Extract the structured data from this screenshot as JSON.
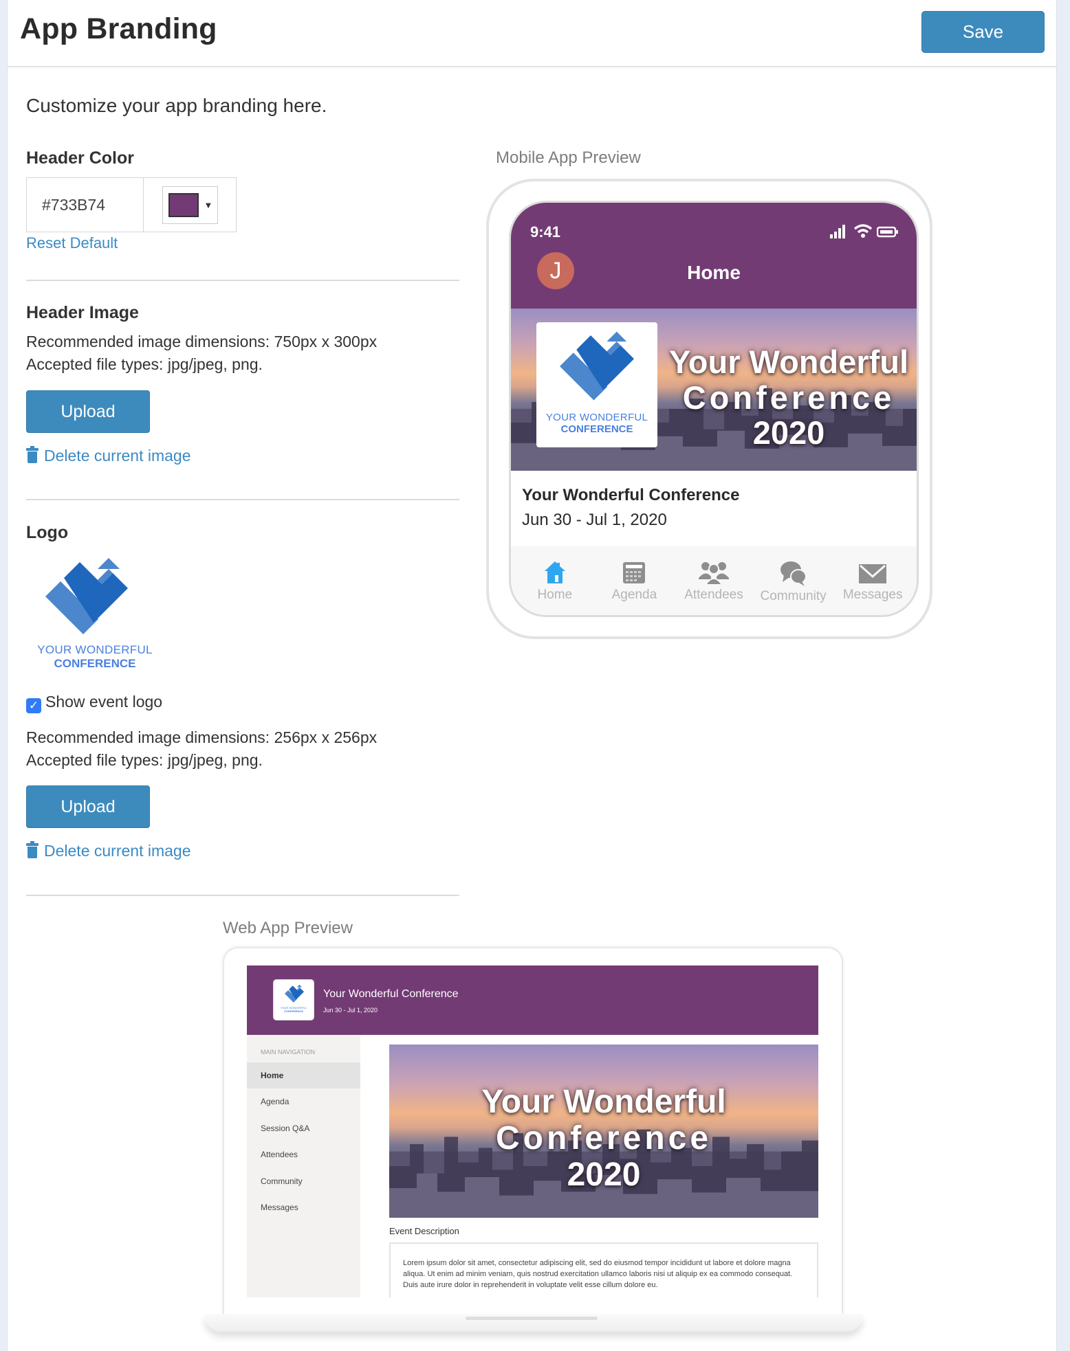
{
  "header": {
    "title": "App Branding",
    "save_label": "Save"
  },
  "intro": "Customize your app branding here.",
  "header_color": {
    "label": "Header Color",
    "value": "#733B74",
    "swatch_color": "#733b74",
    "reset_label": "Reset Default"
  },
  "header_image": {
    "label": "Header Image",
    "dimensions": "Recommended image dimensions: 750px x 300px",
    "file_types": "Accepted file types: jpg/jpeg, png.",
    "upload_label": "Upload",
    "delete_label": "Delete current image"
  },
  "logo": {
    "label": "Logo",
    "logo_line1": "YOUR WONDERFUL",
    "logo_line2": "CONFERENCE",
    "show_logo_label": "Show event logo",
    "show_logo_checked": true,
    "dimensions": "Recommended image dimensions: 256px x 256px",
    "file_types": "Accepted file types: jpg/jpeg, png.",
    "upload_label": "Upload",
    "delete_label": "Delete current image"
  },
  "mobile_preview": {
    "label": "Mobile App Preview",
    "time": "9:41",
    "avatar_initial": "J",
    "screen_title": "Home",
    "hero_line1": "Your Wonderful",
    "hero_line2": "Conference",
    "hero_line3": "2020",
    "event_title": "Your Wonderful Conference",
    "event_dates": "Jun 30 - Jul 1, 2020",
    "tabs": [
      {
        "label": "Home",
        "icon": "home-icon",
        "active": true
      },
      {
        "label": "Agenda",
        "icon": "calendar-icon",
        "active": false
      },
      {
        "label": "Attendees",
        "icon": "people-icon",
        "active": false
      },
      {
        "label": "Community",
        "icon": "chat-bubbles-icon",
        "active": false
      },
      {
        "label": "Messages",
        "icon": "envelope-icon",
        "active": false
      }
    ]
  },
  "web_preview": {
    "label": "Web App Preview",
    "event_title": "Your Wonderful Conference",
    "event_dates": "Jun 30 - Jul 1, 2020",
    "nav_heading": "MAIN NAVIGATION",
    "nav_items": [
      {
        "label": "Home",
        "active": true
      },
      {
        "label": "Agenda",
        "active": false
      },
      {
        "label": "Session Q&A",
        "active": false
      },
      {
        "label": "Attendees",
        "active": false
      },
      {
        "label": "Community",
        "active": false
      },
      {
        "label": "Messages",
        "active": false
      }
    ],
    "hero_line1": "Your Wonderful",
    "hero_line2": "Conference",
    "hero_line3": "2020",
    "description_label": "Event Description",
    "description_text": "Lorem ipsum dolor sit amet, consectetur adipiscing elit, sed do eiusmod tempor incididunt ut labore et dolore magna aliqua. Ut enim ad minim veniam, quis nostrud exercitation ullamco laboris nisi ut aliquip ex ea commodo consequat. Duis aute irure dolor in reprehenderit in voluptate velit esse cillum dolore eu."
  },
  "colors": {
    "brand_header": "#733b74",
    "button": "#3d8bbd",
    "link": "#3b8ac4",
    "active_tab": "#2fa6f0"
  }
}
